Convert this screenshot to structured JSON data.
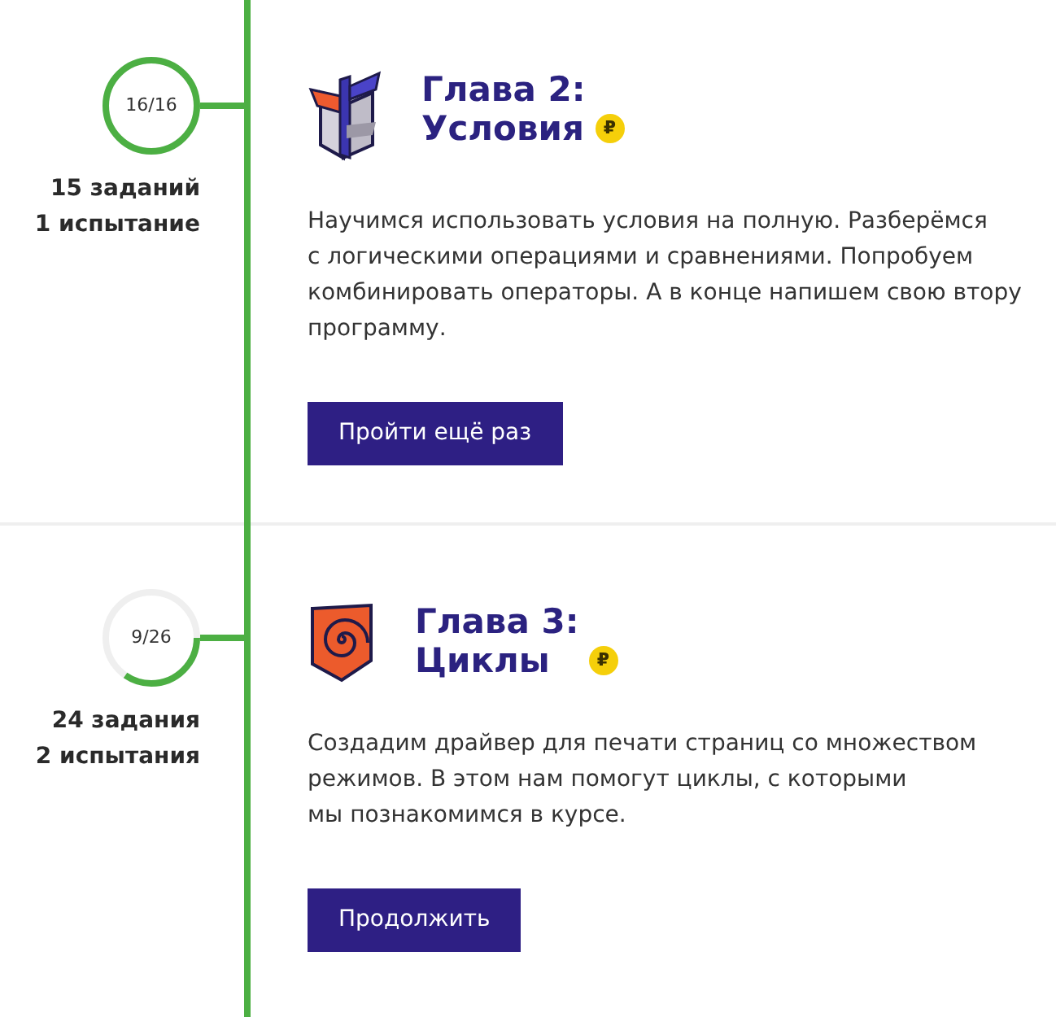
{
  "chapters": [
    {
      "kind": "conditions",
      "progress": "16/16",
      "level": 1,
      "stats": [
        "15 заданий",
        "1 испытание"
      ],
      "title": "Глава 2:\nУсловия",
      "paid_badge": "₽",
      "description": "Научимся использовать условия на полную. Разберёмся\nс логическими операциями и сравнениями. Попробуем\nкомбинировать операторы. А в конце напишем свою втору\nпрограмму.",
      "button": "Пройти ещё раз"
    },
    {
      "kind": "loops",
      "progress": "9/26",
      "level": 0.346,
      "stats": [
        "24 задания",
        "2 испытания"
      ],
      "title": "Глава 3:\nЦиклы",
      "paid_badge": "₽",
      "description": "Создадим драйвер для печати страниц со множеством\nрежимов. В этом нам помогут циклы, с которыми\nмы познакомимся в курсе.",
      "button": "Продолжить"
    }
  ]
}
